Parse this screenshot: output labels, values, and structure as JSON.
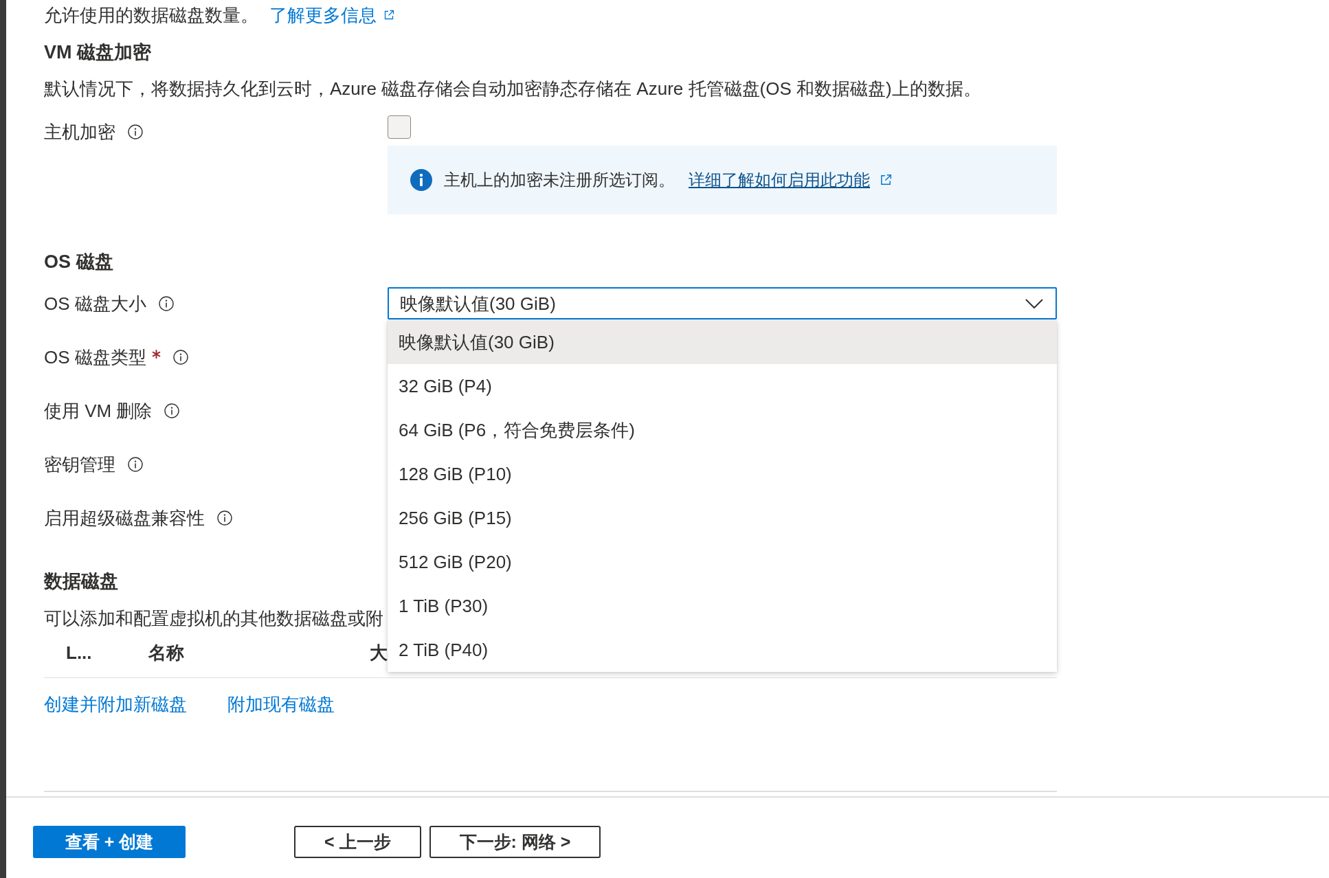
{
  "top_note": {
    "text": "允许使用的数据磁盘数量。",
    "link": "了解更多信息"
  },
  "encryption": {
    "title": "VM 磁盘加密",
    "description": "默认情况下，将数据持久化到云时，Azure 磁盘存储会自动加密静态存储在 Azure 托管磁盘(OS 和数据磁盘)上的数据。",
    "fields": [
      {
        "label": "主机加密",
        "required": false,
        "control": {
          "kind": "checkbox",
          "checked": false,
          "disabled": true
        }
      }
    ],
    "notice": {
      "text": "主机上的加密未注册所选订阅。",
      "link": "详细了解如何启用此功能"
    }
  },
  "os_disk": {
    "title": "OS 磁盘",
    "fields": [
      {
        "label": "OS 磁盘大小",
        "required": false,
        "control": {
          "kind": "dropdown",
          "value": "映像默认值(30 GiB)",
          "expanded": true,
          "options": [
            {
              "label": "映像默认值(30 GiB)",
              "selected": true
            },
            {
              "label": "32 GiB (P4)",
              "selected": false
            },
            {
              "label": "64 GiB (P6，符合免费层条件)",
              "selected": false
            },
            {
              "label": "128 GiB (P10)",
              "selected": false
            },
            {
              "label": "256 GiB (P15)",
              "selected": false
            },
            {
              "label": "512 GiB (P20)",
              "selected": false
            },
            {
              "label": "1 TiB (P30)",
              "selected": false
            },
            {
              "label": "2 TiB (P40)",
              "selected": false
            }
          ]
        }
      },
      {
        "label": "OS 磁盘类型",
        "required": true
      },
      {
        "label": "使用 VM 删除",
        "required": false
      },
      {
        "label": "密钥管理",
        "required": false
      },
      {
        "label": "启用超级磁盘兼容性",
        "required": false
      }
    ]
  },
  "data_disks": {
    "title": "数据磁盘",
    "description": "可以添加和配置虚拟机的其他数据磁盘或附",
    "table": {
      "columns": [
        "L...",
        "名称",
        "大"
      ]
    },
    "links": [
      "创建并附加新磁盘",
      "附加现有磁盘"
    ]
  },
  "footer": {
    "buttons": [
      {
        "label": "查看 + 创建",
        "kind": "primary"
      },
      {
        "label": "< 上一步",
        "kind": "secondary"
      },
      {
        "label": "下一步: 网络 >",
        "kind": "secondary"
      }
    ]
  }
}
